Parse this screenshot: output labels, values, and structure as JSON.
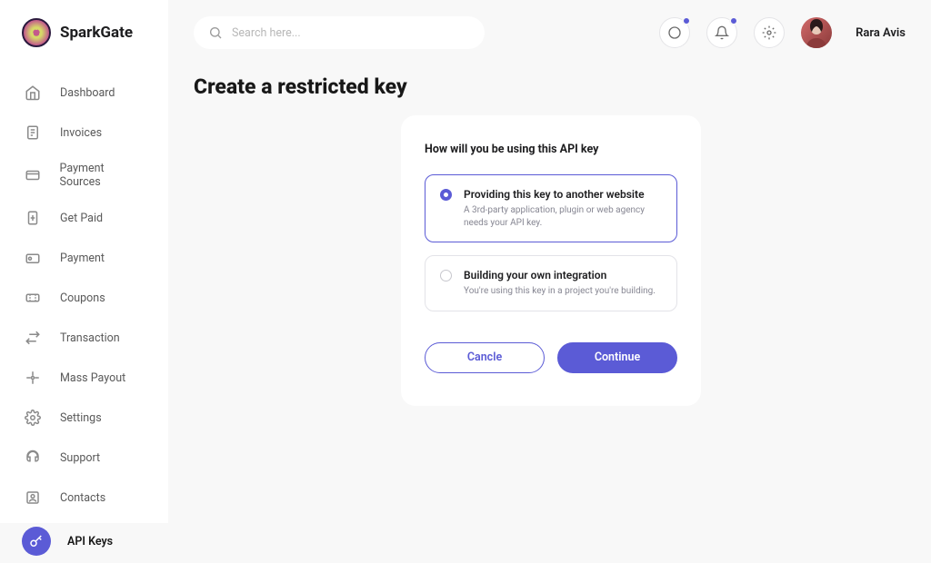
{
  "brand": {
    "name": "SparkGate"
  },
  "search": {
    "placeholder": "Search here..."
  },
  "user": {
    "name": "Rara Avis"
  },
  "sidebar": {
    "items": [
      {
        "label": "Dashboard",
        "icon": "home-icon",
        "active": false
      },
      {
        "label": "Invoices",
        "icon": "invoice-icon",
        "active": false
      },
      {
        "label": "Payment Sources",
        "icon": "card-icon",
        "active": false
      },
      {
        "label": "Get Paid",
        "icon": "get-paid-icon",
        "active": false
      },
      {
        "label": "Payment",
        "icon": "payment-icon",
        "active": false
      },
      {
        "label": "Coupons",
        "icon": "coupon-icon",
        "active": false
      },
      {
        "label": "Transaction",
        "icon": "transaction-icon",
        "active": false
      },
      {
        "label": "Mass Payout",
        "icon": "mass-payout-icon",
        "active": false
      },
      {
        "label": "Settings",
        "icon": "gear-icon",
        "active": false
      },
      {
        "label": "Support",
        "icon": "support-icon",
        "active": false
      },
      {
        "label": "Contacts",
        "icon": "contacts-icon",
        "active": false
      },
      {
        "label": "API  Keys",
        "icon": "key-icon",
        "active": true
      }
    ]
  },
  "page": {
    "title": "Create a restricted key",
    "question": "How will you be using this API key",
    "options": [
      {
        "title": "Providing this key to another website",
        "desc": "A 3rd-party application, plugin or web agency needs your API key.",
        "selected": true
      },
      {
        "title": "Building your own integration",
        "desc": "You're using this key in a project you're building.",
        "selected": false
      }
    ],
    "cancel": "Cancle",
    "continue": "Continue"
  },
  "topbar": {
    "chat_badge": true,
    "bell_badge": true
  }
}
